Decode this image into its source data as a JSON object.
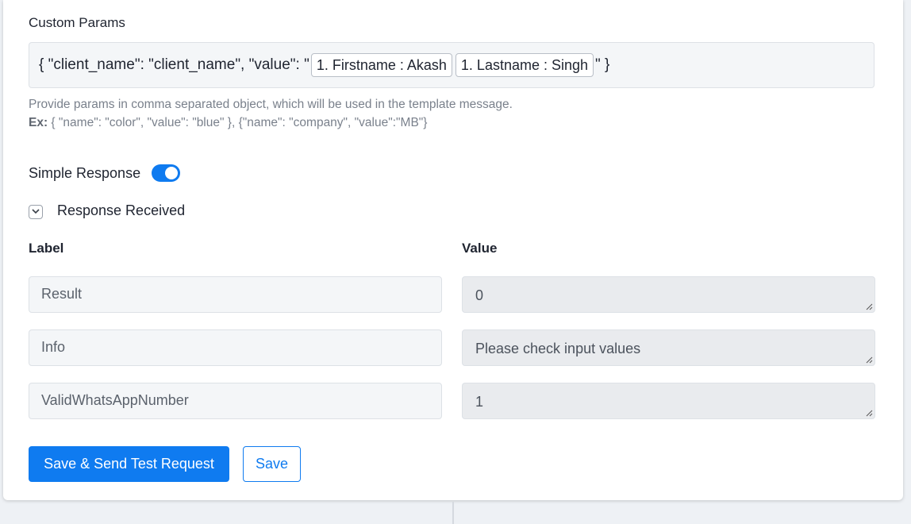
{
  "custom_params": {
    "label": "Custom Params",
    "prefix": "{ \"client_name\": \"client_name\", \"value\": \"",
    "pills": [
      "1. Firstname : Akash",
      "1. Lastname : Singh"
    ],
    "suffix": "\" }",
    "hint_line": "Provide params in comma separated object, which will be used in the template message.",
    "example_label": "Ex:",
    "example_text": " { \"name\": \"color\", \"value\": \"blue\" }, {\"name\": \"company\", \"value\":\"MB\"}"
  },
  "simple_response": {
    "label": "Simple Response",
    "enabled": true,
    "toggle_color": "#0f7bf0"
  },
  "response_received": {
    "label": "Response Received",
    "icon": "chevron-down-icon"
  },
  "table": {
    "label_header": "Label",
    "value_header": "Value",
    "rows": [
      {
        "label": "Result",
        "value": "0"
      },
      {
        "label": "Info",
        "value": "Please check input values"
      },
      {
        "label": "ValidWhatsAppNumber",
        "value": "1"
      }
    ]
  },
  "actions": {
    "save_send_label": "Save & Send Test Request",
    "save_label": "Save",
    "accent_color": "#0f7bf0"
  }
}
